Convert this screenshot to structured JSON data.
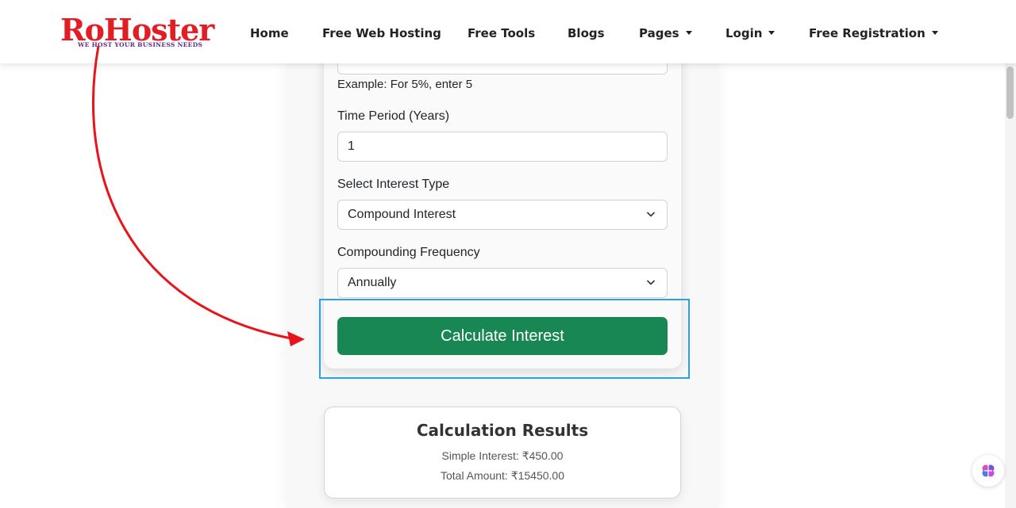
{
  "brand": {
    "name": "RoHoster",
    "tagline": "WE HOST YOUR BUSINESS NEEDS",
    "color": "#e31d24"
  },
  "nav": {
    "items": [
      {
        "label": "Home",
        "dropdown": false
      },
      {
        "label": "Free Web Hosting",
        "dropdown": false
      },
      {
        "label": "Free Tools",
        "dropdown": false
      },
      {
        "label": "Blogs",
        "dropdown": false
      },
      {
        "label": "Pages",
        "dropdown": true
      },
      {
        "label": "Login",
        "dropdown": true
      },
      {
        "label": "Free Registration",
        "dropdown": true
      }
    ]
  },
  "form": {
    "rate_hint": "Example: For 5%, enter 5",
    "time_label": "Time Period (Years)",
    "time_value": "1",
    "interest_type_label": "Select Interest Type",
    "interest_type_value": "Compound Interest",
    "frequency_label": "Compounding Frequency",
    "frequency_value": "Annually",
    "submit_label": "Calculate Interest",
    "submit_color": "#198754"
  },
  "results": {
    "title": "Calculation Results",
    "simple_interest": "Simple Interest: ₹450.00",
    "total_amount": "Total Amount: ₹15450.00"
  },
  "annotation": {
    "highlight_color": "#2aa0e6",
    "arrow_color": "#e8141c"
  }
}
